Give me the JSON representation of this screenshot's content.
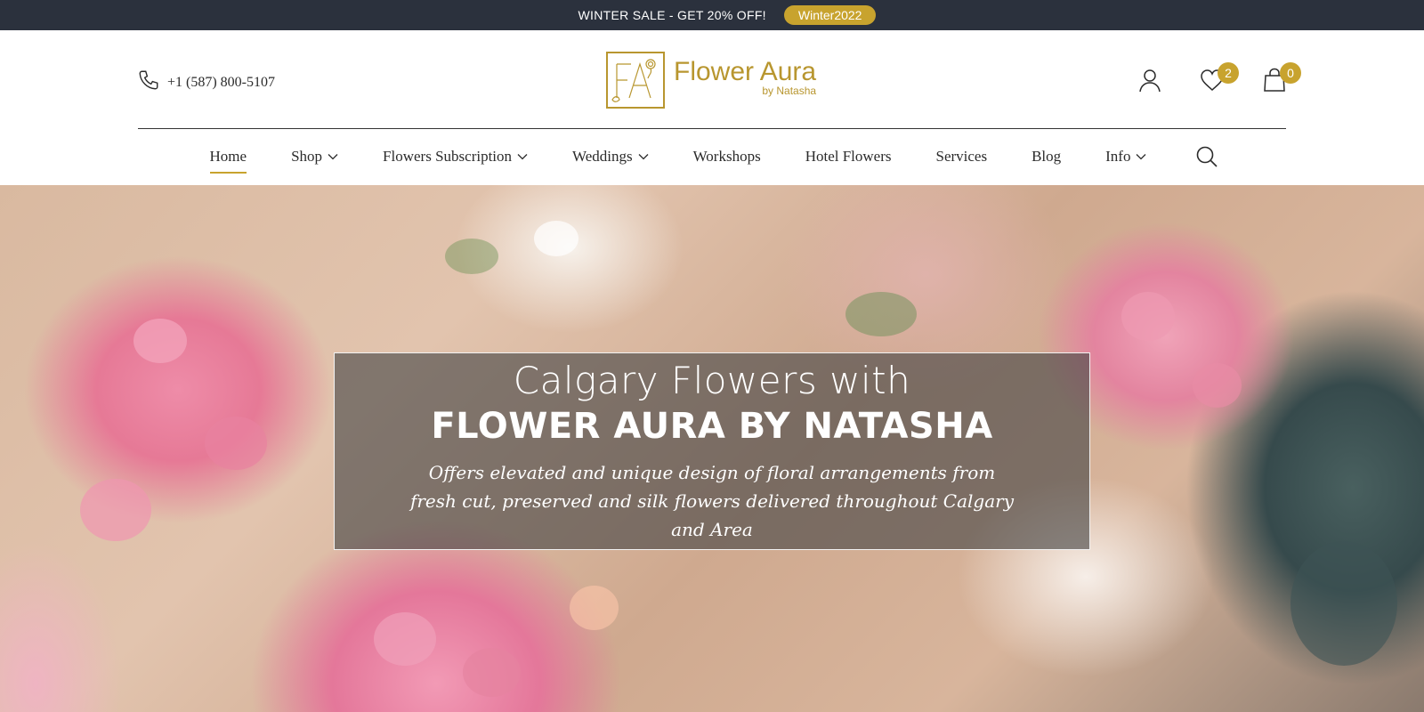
{
  "promo": {
    "text": "WINTER SALE - GET 20% OFF!",
    "code": "Winter2022"
  },
  "header": {
    "phone": "+1 (587) 800-5107",
    "logo_name": "Flower Aura",
    "logo_sub": "by Natasha",
    "wishlist_count": "2",
    "cart_count": "0"
  },
  "nav": {
    "items": [
      {
        "label": "Home",
        "active": true,
        "dropdown": false
      },
      {
        "label": "Shop",
        "active": false,
        "dropdown": true
      },
      {
        "label": "Flowers Subscription",
        "active": false,
        "dropdown": true
      },
      {
        "label": "Weddings",
        "active": false,
        "dropdown": true
      },
      {
        "label": "Workshops",
        "active": false,
        "dropdown": false
      },
      {
        "label": "Hotel Flowers",
        "active": false,
        "dropdown": false
      },
      {
        "label": "Services",
        "active": false,
        "dropdown": false
      },
      {
        "label": "Blog",
        "active": false,
        "dropdown": false
      },
      {
        "label": "Info",
        "active": false,
        "dropdown": true
      }
    ]
  },
  "hero": {
    "title_line1": "Calgary Flowers with",
    "title_line2": "FLOWER AURA BY NATASHA",
    "subtitle": "Offers elevated and unique design of floral arrangements from fresh cut, preserved and silk flowers delivered throughout Calgary and Area"
  },
  "colors": {
    "accent": "#c8a32e",
    "promo_bg": "#2b313d",
    "logo": "#b8962f"
  },
  "icons": {
    "phone": "phone-icon",
    "account": "user-icon",
    "wishlist": "heart-icon",
    "cart": "shopping-bag-icon",
    "search": "search-icon",
    "dropdown": "chevron-down-icon"
  }
}
